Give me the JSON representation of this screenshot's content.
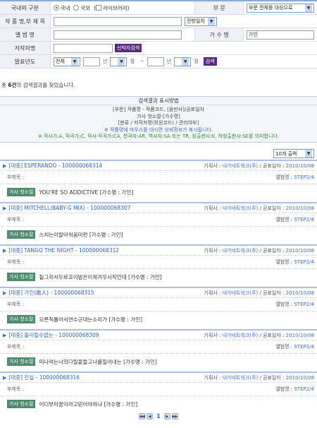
{
  "form": {
    "region_label": "국내외 구분",
    "region_options": [
      "국내",
      "국외",
      "라이브러리"
    ],
    "section_label": "부 문",
    "section_value": "부문 전체를 대상으로",
    "title_label": "작 품 명,부 제 목",
    "title_value": "",
    "match_value": "전방일치",
    "album_label": "앨 범 명",
    "album_value": "",
    "singer_label": "가 수 명",
    "singer_value": "가인",
    "author_label": "저작자명",
    "author_value": "",
    "author_button": "신탁자검색",
    "year_label": "발표년도",
    "year_type": "전체",
    "year_unit": "년",
    "month_unit": "월",
    "range_sep": "~",
    "search_button": "검색"
  },
  "result_count": {
    "prefix": "총",
    "count": "6건",
    "suffix": "의 검색결과를 찾았습니다."
  },
  "info": {
    "heading": "검색결과 표시방법",
    "lines": [
      "[부문] 작품명 - 작품코드, [음반사]/공표일자",
      "가사 첫소절-[가수명]",
      "[분류 / 저작자명(회원코드) / 관리여부]"
    ],
    "note_blue": "※ 작품명에 마우스를 대시면 상세정보가 표시됩니다.",
    "note_green": "※ 작사가:A, 작곡가:C, 작사·작곡가:CA, 편곡자:AR, 역사자:SA 또는 TR, 원출판사:E, 하청출판사:SE를 의미합니다."
  },
  "per_page": "10개 출력",
  "labels": {
    "planner": "기획사 :",
    "publisher": "내가네트워크(주)",
    "pubdate_label": "/ 공표일자 :",
    "subtitle": "부제목 :",
    "album": "앨범명 :",
    "lyrics_badge": "가사 첫소절"
  },
  "results": [
    {
      "title": "[대중] ESPERANDO - 100000068314",
      "date": "2010/10/08",
      "album": "STEP2/4",
      "lyrics": "YOU'RE SO ADDICTIVE [가수명 : 가인]"
    },
    {
      "title": "[대중] MITCHELL(BABY-G MIX) - 100000068307",
      "date": "2010/10/08",
      "album": "STEP2/4",
      "lyrics": "스치는이발아쉬움미련 [가수명 : 가인]"
    },
    {
      "title": "[대중] TANGO THE NIGHT - 100000068312",
      "date": "2010/10/08",
      "album": "STEP2/4",
      "lyrics": "될그리서두로죠이밤은이제겨우시작인데 [가수명 : 가인]"
    },
    {
      "title": "[대중] 가인(歌人) - 100000068315",
      "date": "2010/10/08",
      "album": "STEP2/4",
      "lyrics": "모른척톨아서면수군대는소리가 [가수명 : 가인]"
    },
    {
      "title": "[대중] 돌이킬수없는 - 100000068309",
      "date": "2010/10/08",
      "album": "STEP2/4",
      "lyrics": "떠나려는너의다릴붙들고나를밀어내는 [가수명 : 가인]"
    },
    {
      "title": "[대중] 진실 - 100000068316",
      "date": "2010/10/08",
      "album": "STEP2/4",
      "lyrics": "어디부터꿈이라고믿어야하냐 [가수명 : 가인]"
    }
  ],
  "pager": {
    "first": "◀◀",
    "prev": "◀",
    "page": "1",
    "next": "▶",
    "last": "▶▶"
  }
}
